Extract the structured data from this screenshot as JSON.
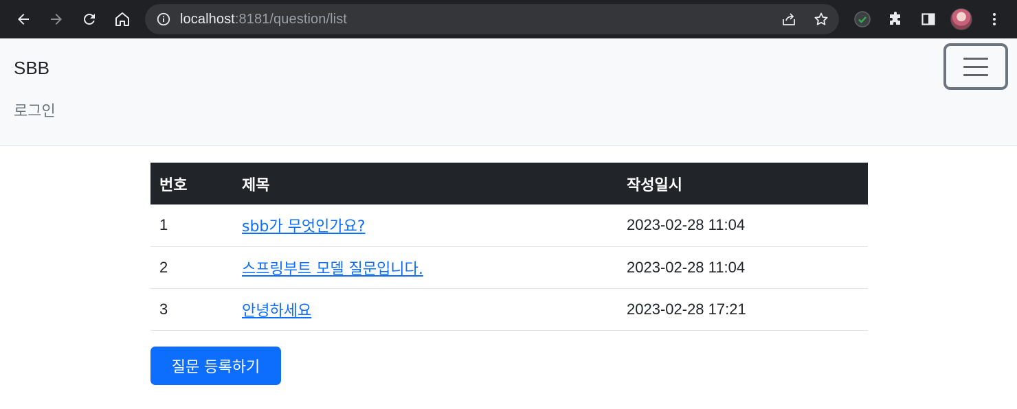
{
  "browser": {
    "url_host": "localhost",
    "url_rest": ":8181/question/list"
  },
  "navbar": {
    "brand": "SBB",
    "login": "로그인"
  },
  "table": {
    "headers": [
      "번호",
      "제목",
      "작성일시"
    ],
    "rows": [
      {
        "num": "1",
        "subject": "sbb가 무엇인가요?",
        "date": "2023-02-28 11:04"
      },
      {
        "num": "2",
        "subject": "스프링부트 모델 질문입니다.",
        "date": "2023-02-28 11:04"
      },
      {
        "num": "3",
        "subject": "안녕하세요",
        "date": "2023-02-28 17:21"
      }
    ]
  },
  "actions": {
    "create_label": "질문 등록하기"
  },
  "colors": {
    "chrome_bg": "#202124",
    "navbar_bg": "#f8f9fa",
    "table_header_bg": "#212529",
    "link": "#0d6efd",
    "primary_button": "#0d6efd"
  }
}
